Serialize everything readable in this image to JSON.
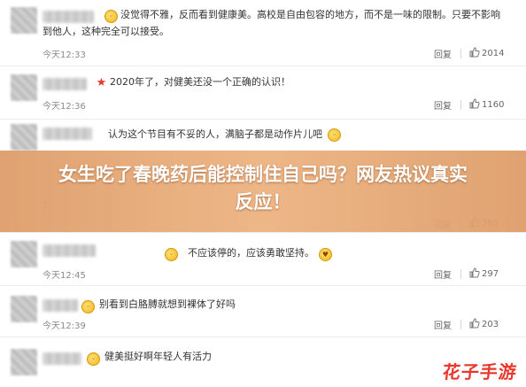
{
  "comments": [
    {
      "text_line1": "没觉得不雅，反而看到健康美。高校是自由包容的地方，而不是一味的限制。只要不影响",
      "text_line2": "到他人，这种完全可以接受。",
      "time": "今天12:33",
      "reply": "回复",
      "likes": "2014",
      "emoji": "smile-emoji-icon"
    },
    {
      "text_line1": "2020年了，对健美还没一个正确的认识！",
      "time": "今天12:36",
      "reply": "回复",
      "likes": "1160",
      "emoji": "star-icon"
    },
    {
      "text_line1": "认为这个节目有不妥的人，满脑子都是动作片儿吧",
      "time": "",
      "reply": "",
      "likes": "",
      "emoji": "smile-emoji-icon"
    },
    {
      "text_line1": "片",
      "time": "",
      "reply": "回复",
      "likes": "365"
    },
    {
      "text_line1": "不应该停的，应该勇敢坚持。",
      "time": "今天12:45",
      "reply": "回复",
      "likes": "297",
      "emoji": "heart-eyes-emoji-icon"
    },
    {
      "text_line1": "别看到白胳膊就想到裸体了好吗",
      "time": "今天12:39",
      "reply": "回复",
      "likes": "203",
      "emoji": "smile-emoji-icon"
    },
    {
      "text_line1": "健美挺好啊年轻人有活力",
      "time": "",
      "reply": "",
      "likes": "",
      "emoji": "smile-emoji-icon"
    }
  ],
  "headline": {
    "line1": "女生吃了春晚药后能控制住自己吗？网友热议真实",
    "line2": "反应！"
  },
  "watermark": "花子手游",
  "colors": {
    "banner": "#e3a373",
    "watermark": "#e8382b",
    "time": "#8a8a8a"
  }
}
